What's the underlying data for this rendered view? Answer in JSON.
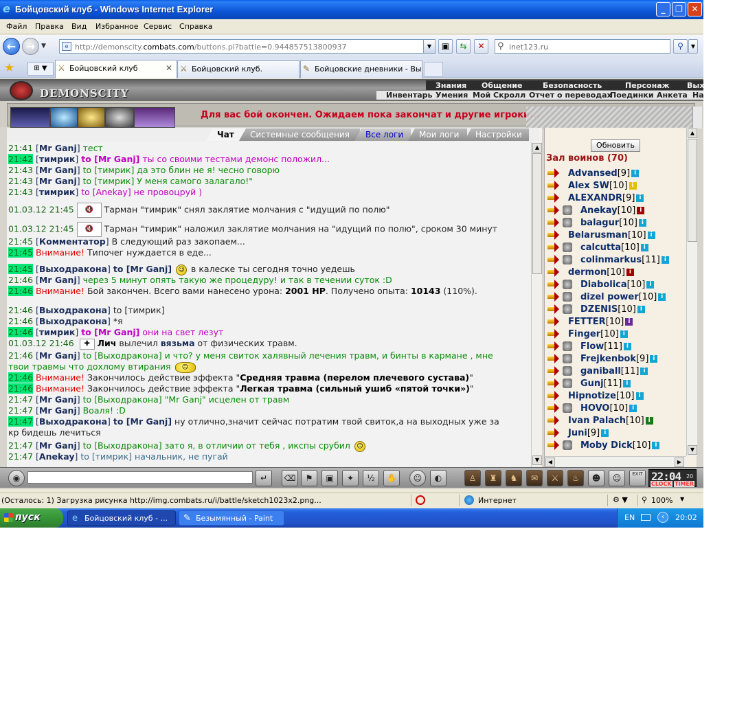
{
  "window": {
    "title": "Бойцовский клуб - Windows Internet Explorer"
  },
  "menubar": [
    "Файл",
    "Правка",
    "Вид",
    "Избранное",
    "Сервис",
    "Справка"
  ],
  "address": {
    "url_prefix": "http://demonscity.",
    "url_domain": "combats.com",
    "url_suffix": "/buttons.pl?battle=0.944857513800937",
    "search_value": "inet123.ru"
  },
  "tabs": [
    {
      "label": "Бойцовский клуб",
      "active": true
    },
    {
      "label": "Бойцовский клуб.",
      "active": false
    },
    {
      "label": "Бойцовские дневники - Вы...",
      "active": false
    }
  ],
  "game": {
    "logo": "DEMONSCITY",
    "top_menu": [
      "Знания",
      "Общение",
      "Безопасность",
      "Персонаж",
      "Вых"
    ],
    "sub_menu": [
      "Инвентарь",
      "Умения",
      "Мой Скролл",
      "Отчет о переводах",
      "Поединки",
      "Анкета",
      "На"
    ],
    "battle_message": "Для вас бой окончен. Ожидаем пока закончат и другие игроки..."
  },
  "chat": {
    "tabs": [
      "Чат",
      "Системные сообщения",
      "Все логи",
      "Мои логи",
      "Настройки"
    ],
    "messages": [
      {
        "time": "21:41",
        "parts": [
          "[",
          "Mr Ganj",
          "] ",
          "тест"
        ]
      },
      {
        "time": "21:42",
        "parts": [
          "[",
          "тимрик",
          "] ",
          "to [Mr Ganj]",
          " ты со своими тестами демонс положил..."
        ]
      },
      {
        "time": "21:43",
        "parts": [
          "[",
          "Mr Ganj",
          "] ",
          "to [тимрик] да это блин не я! чесно говорю"
        ]
      },
      {
        "time": "21:43",
        "parts": [
          "[",
          "Mr Ganj",
          "] ",
          "to [тимрик] У меня самого залагало!\""
        ]
      },
      {
        "time": "21:43",
        "parts": [
          "[",
          "тимрик",
          "] ",
          "to [Anekay] не провоцруй )"
        ]
      },
      {
        "time": "01.03.12 21:45",
        "parts": [
          "Тарман \"тимрик\" снял заклятие молчания с \"идущий по полю\""
        ]
      },
      {
        "time": "01.03.12 21:45",
        "parts": [
          "Тарман \"тимрик\" наложил заклятие молчания на \"идущий по полю\", сроком 30 минут"
        ]
      },
      {
        "time": "21:45",
        "parts": [
          "[",
          "Комментатор",
          "] ",
          "В следующий раз закопаем..."
        ]
      },
      {
        "time": "21:45",
        "parts": [
          "Внимание!",
          " Типочег нуждается в еде..."
        ]
      },
      {
        "time": "21:45",
        "parts": [
          "[",
          "Выходракона",
          "] ",
          "to [Mr Ganj]",
          " в калеске ты сегодня точно уедешь"
        ]
      },
      {
        "time": "21:46",
        "parts": [
          "[",
          "Mr Ganj",
          "] ",
          "через 5 минут опять такую же процедуру! и так в течении суток :D"
        ]
      },
      {
        "time": "21:46",
        "parts": [
          "Внимание!",
          " Бой закончен. Всего вами нанесено урона: ",
          "2001 HP",
          ". Получено опыта: ",
          "10143",
          " (110%)."
        ]
      },
      {
        "time": "21:46",
        "parts": [
          "[",
          "Выходракона",
          "] ",
          "to [тимрик]"
        ]
      },
      {
        "time": "21:46",
        "parts": [
          "[",
          "Выходракона",
          "] ",
          "*я"
        ]
      },
      {
        "time": "21:46",
        "parts": [
          "[",
          "тимрик",
          "] ",
          "to [Mr Ganj]",
          " они на свет лезут"
        ]
      },
      {
        "time": "01.03.12 21:46",
        "parts": [
          "Лич",
          " вылечил ",
          "вязьма",
          " от физических травм."
        ]
      },
      {
        "time": "21:46",
        "parts": [
          "[",
          "Mr Ganj",
          "] ",
          "to [Выходракона] и что? у меня свиток халявный лечения травм, и бинты в кармане , мне"
        ]
      },
      {
        "time": "",
        "parts": [
          "твои травмы что дохлому втирания"
        ]
      },
      {
        "time": "21:46",
        "parts": [
          "Внимание!",
          " Закончилось действие эффекта \"",
          "Средняя травма (перелом плечевого сустава)",
          "\""
        ]
      },
      {
        "time": "21:46",
        "parts": [
          "Внимание!",
          " Закончилось действие эффекта \"",
          "Легкая травма (сильный ушиб «пятой точки»)",
          "\""
        ]
      },
      {
        "time": "21:47",
        "parts": [
          "[",
          "Mr Ganj",
          "] ",
          "to [Выходракона] \"Mr Ganj\" исцелен от травм"
        ]
      },
      {
        "time": "21:47",
        "parts": [
          "[",
          "Mr Ganj",
          "] ",
          "Воаля! :D"
        ]
      },
      {
        "time": "21:47",
        "parts": [
          "[",
          "Выходракона",
          "] ",
          "to [Mr Ganj]",
          " ну отлично,значит сейчас потратим твой свиток,а на выходных уже за"
        ]
      },
      {
        "time": "",
        "parts": [
          "кр бидешь лечиться"
        ]
      },
      {
        "time": "21:47",
        "parts": [
          "[",
          "Mr Ganj",
          "] ",
          "to [Выходракона] зато я, в отличии от тебя , икспы срубил"
        ]
      },
      {
        "time": "21:47",
        "parts": [
          "[",
          "Anekay",
          "] ",
          "to [тимрик] начальник, не пугай"
        ]
      }
    ]
  },
  "players": {
    "refresh_label": "Обновить",
    "hall_title": "Зал воинов (70)",
    "list": [
      {
        "name": "Advansed",
        "level": "[9]"
      },
      {
        "name": "Alex SW",
        "level": "[10]"
      },
      {
        "name": "ALEXANDR",
        "level": "[9]"
      },
      {
        "name": "Anekay",
        "level": "[10]"
      },
      {
        "name": "balagur",
        "level": "[10]"
      },
      {
        "name": "Belarusman",
        "level": "[10]"
      },
      {
        "name": "calcutta",
        "level": "[10]"
      },
      {
        "name": "colinmarkus",
        "level": "[11]"
      },
      {
        "name": "dermon",
        "level": "[10]"
      },
      {
        "name": "Diabolica",
        "level": "[10]"
      },
      {
        "name": "dizel power",
        "level": "[10]"
      },
      {
        "name": "DZENIS",
        "level": "[10]"
      },
      {
        "name": "FETTER",
        "level": "[10]"
      },
      {
        "name": "Finger",
        "level": "[10]"
      },
      {
        "name": "Flow",
        "level": "[11]"
      },
      {
        "name": "Frejkenbok",
        "level": "[9]"
      },
      {
        "name": "ganiball",
        "level": "[11]"
      },
      {
        "name": "Gunj",
        "level": "[11]"
      },
      {
        "name": "Hipnotize",
        "level": "[10]"
      },
      {
        "name": "HOVO",
        "level": "[10]"
      },
      {
        "name": "Ivan Palach",
        "level": "[10]"
      },
      {
        "name": "Juni",
        "level": "[9]"
      },
      {
        "name": "Moby Dick",
        "level": "[10]"
      }
    ]
  },
  "clock": {
    "time": "22:04",
    "seconds": "20",
    "clock_label": "CLOCK",
    "timer_label": "TIMER"
  },
  "statusbar": {
    "text": "(Осталось: 1) Загрузка рисунка http://img.combats.ru/i/battle/sketch1023x2.png...",
    "zone": "Интернет",
    "zoom": "100%"
  },
  "taskbar": {
    "start": "пуск",
    "tasks": [
      "Бойцовский клуб - ...",
      "Безымянный - Paint"
    ],
    "lang": "EN",
    "time": "20:02"
  }
}
